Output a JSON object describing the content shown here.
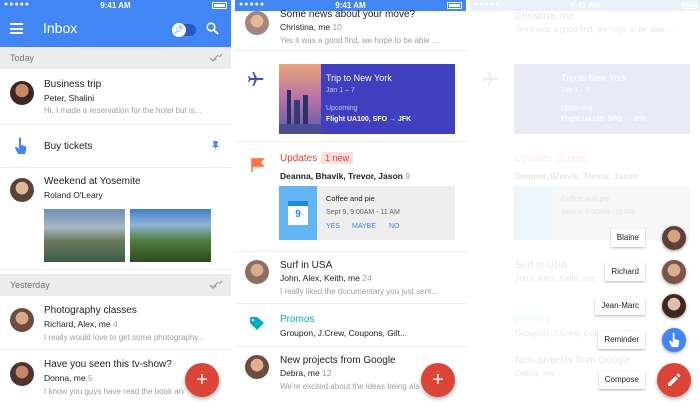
{
  "status_bar": {
    "time": "9:41 AM"
  },
  "inbox": {
    "title": "Inbox",
    "sections": {
      "today": "Today",
      "yesterday": "Yesterday"
    },
    "items": [
      {
        "title": "Business trip",
        "participants": "Peter, Shalini",
        "snippet": "Hi, I made a reservation for the hotel but is..."
      },
      {
        "title": "Buy tickets"
      },
      {
        "title": "Weekend at Yosemite",
        "participants": "Roland O'Leary"
      },
      {
        "title": "Photography classes",
        "participants": "Richard, Alex, me",
        "count": "4",
        "snippet": "I really would love to get some photography..."
      },
      {
        "title": "Have you seen this tv-show?",
        "participants": "Donna, me",
        "count": "5",
        "snippet": "I know you guys have read the book and..."
      }
    ],
    "compose_fab": "+"
  },
  "second": {
    "items": [
      {
        "title": "Some news about your move?",
        "participants": "Christina, me",
        "count": "10",
        "snippet": "Yes it was a good find, we hope to be able ..."
      },
      {
        "title": "Surf in USA",
        "participants": "John, Alex, Keith, me",
        "count": "24",
        "snippet": "I really liked the documentary you just sent..."
      },
      {
        "title": "Promos",
        "participants": "Groupon, J.Crew, Coupons, Gilt..."
      },
      {
        "title": "New projects from Google",
        "participants": "Debra, me",
        "count": "12",
        "snippet": "We're excited about the ideas being also..."
      }
    ],
    "trip": {
      "title": "Trip to New York",
      "dates": "Jan 1 – 7",
      "status": "Upcoming",
      "flight": "Flight UA100, SFO → JFK"
    },
    "updates": {
      "title": "Updates",
      "badge": "1 new",
      "participants": "Deanna, Bhavik, Trevor, Jason",
      "count": "9"
    },
    "event": {
      "title": "Coffee and pie",
      "time": "Sept 9, 9:00AM - 11 AM",
      "day": "9",
      "rsvp": [
        "YES",
        "MAYBE",
        "NO"
      ]
    },
    "compose_fab": "+"
  },
  "speed_dial": {
    "items": [
      {
        "label": "Blaine"
      },
      {
        "label": "Richard"
      },
      {
        "label": "Jean-Marc"
      },
      {
        "label": "Reminder"
      },
      {
        "label": "Compose"
      }
    ]
  },
  "colors": {
    "primary": "#4285f4",
    "accent": "#db4437",
    "trip_card": "#3f3fbf",
    "promo": "#00acc1",
    "section_bg": "#ececec"
  },
  "icons": [
    "menu-icon",
    "pin-icon",
    "search-icon",
    "sweep-icon",
    "plane-icon",
    "flag-icon",
    "tag-icon",
    "calendar-icon",
    "pencil-icon",
    "reminder-hand-icon"
  ]
}
